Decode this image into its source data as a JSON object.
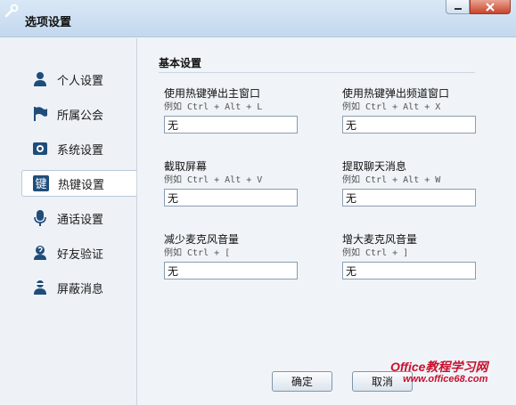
{
  "window": {
    "title": "选项设置",
    "app_icon": "wrench-icon",
    "minimize_icon": "minimize-icon",
    "close_icon": "close-icon",
    "accent": "#c8442b"
  },
  "sidebar": {
    "items": [
      {
        "label": "个人设置",
        "icon": "person-icon"
      },
      {
        "label": "所属公会",
        "icon": "flag-icon"
      },
      {
        "label": "系统设置",
        "icon": "system-settings-icon"
      },
      {
        "label": "热键设置",
        "icon": "hotkey-icon",
        "icon_char": "键",
        "active": true
      },
      {
        "label": "通话设置",
        "icon": "microphone-icon"
      },
      {
        "label": "好友验证",
        "icon": "friend-verify-icon"
      },
      {
        "label": "屏蔽消息",
        "icon": "block-message-icon"
      }
    ]
  },
  "section": {
    "title": "基本设置",
    "fields": [
      {
        "label": "使用热键弹出主窗口",
        "hint": "例如 Ctrl + Alt + L",
        "value": "无"
      },
      {
        "label": "使用热键弹出频道窗口",
        "hint": "例如 Ctrl + Alt + X",
        "value": "无"
      },
      {
        "label": "截取屏幕",
        "hint": "例如 Ctrl + Alt + V",
        "value": "无"
      },
      {
        "label": "提取聊天消息",
        "hint": "例如 Ctrl + Alt + W",
        "value": "无"
      },
      {
        "label": "减少麦克风音量",
        "hint": "例如 Ctrl + [",
        "value": "无"
      },
      {
        "label": "增大麦克风音量",
        "hint": "例如 Ctrl + ]",
        "value": "无"
      }
    ]
  },
  "buttons": {
    "ok": "确定",
    "cancel": "取消"
  },
  "watermark": {
    "line1": "Office教程学习网",
    "line2": "www.office68.com"
  }
}
